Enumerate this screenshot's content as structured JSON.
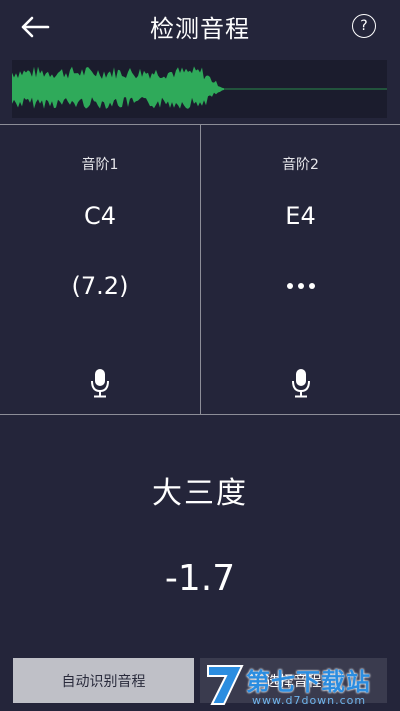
{
  "header": {
    "title": "检测音程",
    "help_label": "?"
  },
  "notes": [
    {
      "label": "音阶1",
      "note": "C4",
      "freq": "(7.2)"
    },
    {
      "label": "音阶2",
      "note": "E4"
    }
  ],
  "result": {
    "interval": "大三度",
    "cents": "-1.7"
  },
  "buttons": {
    "auto": "自动识别音程",
    "select": "选择音程"
  },
  "watermark": {
    "brand": "第七下载站",
    "url": "www.d7down.com"
  },
  "colors": {
    "background": "#24253a",
    "waveform": "#2faa5a",
    "divider": "#8d8e98"
  }
}
